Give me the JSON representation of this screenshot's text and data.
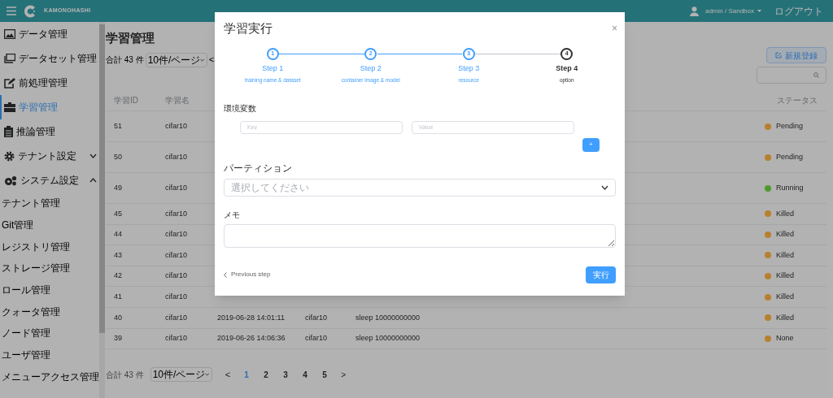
{
  "header": {
    "brand": "KAMONOHASHI",
    "user": "admin / Sandbox",
    "logout": "ログアウト"
  },
  "sidebar": {
    "items": [
      {
        "label": "データ管理",
        "selected": false
      },
      {
        "label": "データセット管理",
        "selected": false
      },
      {
        "label": "前処理管理",
        "selected": false
      },
      {
        "label": "学習管理",
        "selected": true
      },
      {
        "label": "推論管理",
        "selected": false
      },
      {
        "label": "テナント設定",
        "selected": false,
        "expanded": false
      },
      {
        "label": "システム設定",
        "selected": false,
        "expanded": true,
        "children": [
          {
            "label": "テナント管理",
            "selected": false
          },
          {
            "label": "Git管理",
            "selected": false
          },
          {
            "label": "レジストリ管理",
            "selected": false
          },
          {
            "label": "ストレージ管理",
            "selected": false
          },
          {
            "label": "ロール管理",
            "selected": false
          },
          {
            "label": "クォータ管理",
            "selected": false
          },
          {
            "label": "ノード管理",
            "selected": false
          },
          {
            "label": "ユーザ管理",
            "selected": false
          },
          {
            "label": "メニューアクセス管理",
            "selected": false
          }
        ]
      }
    ]
  },
  "main": {
    "title": "学習管理",
    "total": "合計 43 件",
    "page_size": "10件/ページ",
    "prev": "<",
    "new_button": "新規登録",
    "table": {
      "columns": [
        "学習ID",
        "学習名",
        "ステータス"
      ],
      "rows": [
        {
          "id": "51",
          "name": "cifar10",
          "status": "Pending",
          "color": "#b8802e"
        },
        {
          "id": "50",
          "name": "cifar10",
          "status": "Pending",
          "color": "#b8802e"
        },
        {
          "id": "49",
          "name": "cifar10",
          "status": "Running",
          "color": "#4f9a2c"
        },
        {
          "id": "45",
          "name": "cifar10",
          "status": "Killed",
          "color": "#b8802e"
        },
        {
          "id": "44",
          "name": "cifar10",
          "status": "Killed",
          "color": "#b8802e"
        },
        {
          "id": "43",
          "name": "cifar10",
          "status": "Killed",
          "color": "#b8802e"
        },
        {
          "id": "42",
          "name": "cifar10",
          "status": "Killed",
          "color": "#b8802e"
        },
        {
          "id": "41",
          "name": "cifar10",
          "status": "Killed",
          "color": "#b8802e"
        },
        {
          "id": "40",
          "name": "cifar10",
          "started": "2019-06-28 14:01:11",
          "model": "cifar10",
          "command": "sleep 10000000000",
          "status": "Killed",
          "color": "#b8802e"
        },
        {
          "id": "39",
          "name": "cifar10",
          "started": "2019-06-26 14:06:36",
          "model": "cifar10",
          "command": "sleep 10000000000",
          "status": "None",
          "color": "#b8802e"
        }
      ]
    },
    "pagination": {
      "total": "合計 43 件",
      "page_size": "10件/ページ",
      "prev": "<",
      "next": ">",
      "pages": [
        {
          "label": "1",
          "selected": true
        },
        {
          "label": "2",
          "selected": false
        },
        {
          "label": "3",
          "selected": false
        },
        {
          "label": "4",
          "selected": false
        },
        {
          "label": "5",
          "selected": false
        }
      ]
    }
  },
  "dialog": {
    "title": "学習実行",
    "close": "×",
    "steps": [
      {
        "number": "1",
        "title": "Step 1",
        "subtitle": "training name & dataset",
        "done": true,
        "selected": false
      },
      {
        "number": "2",
        "title": "Step 2",
        "subtitle": "container image & model",
        "done": true,
        "selected": false
      },
      {
        "number": "3",
        "title": "Step 3",
        "subtitle": "resource",
        "done": true,
        "selected": false
      },
      {
        "number": "4",
        "title": "Step 4",
        "subtitle": "option",
        "done": false,
        "selected": true
      }
    ],
    "env_label": "環境変数",
    "key_placeholder": "Key",
    "value_placeholder": "Value",
    "add_button": "+",
    "partition_label": "パーティション",
    "partition_placeholder": "選択してください",
    "memo_label": "メモ",
    "previous": "Previous step",
    "submit": "実行"
  }
}
